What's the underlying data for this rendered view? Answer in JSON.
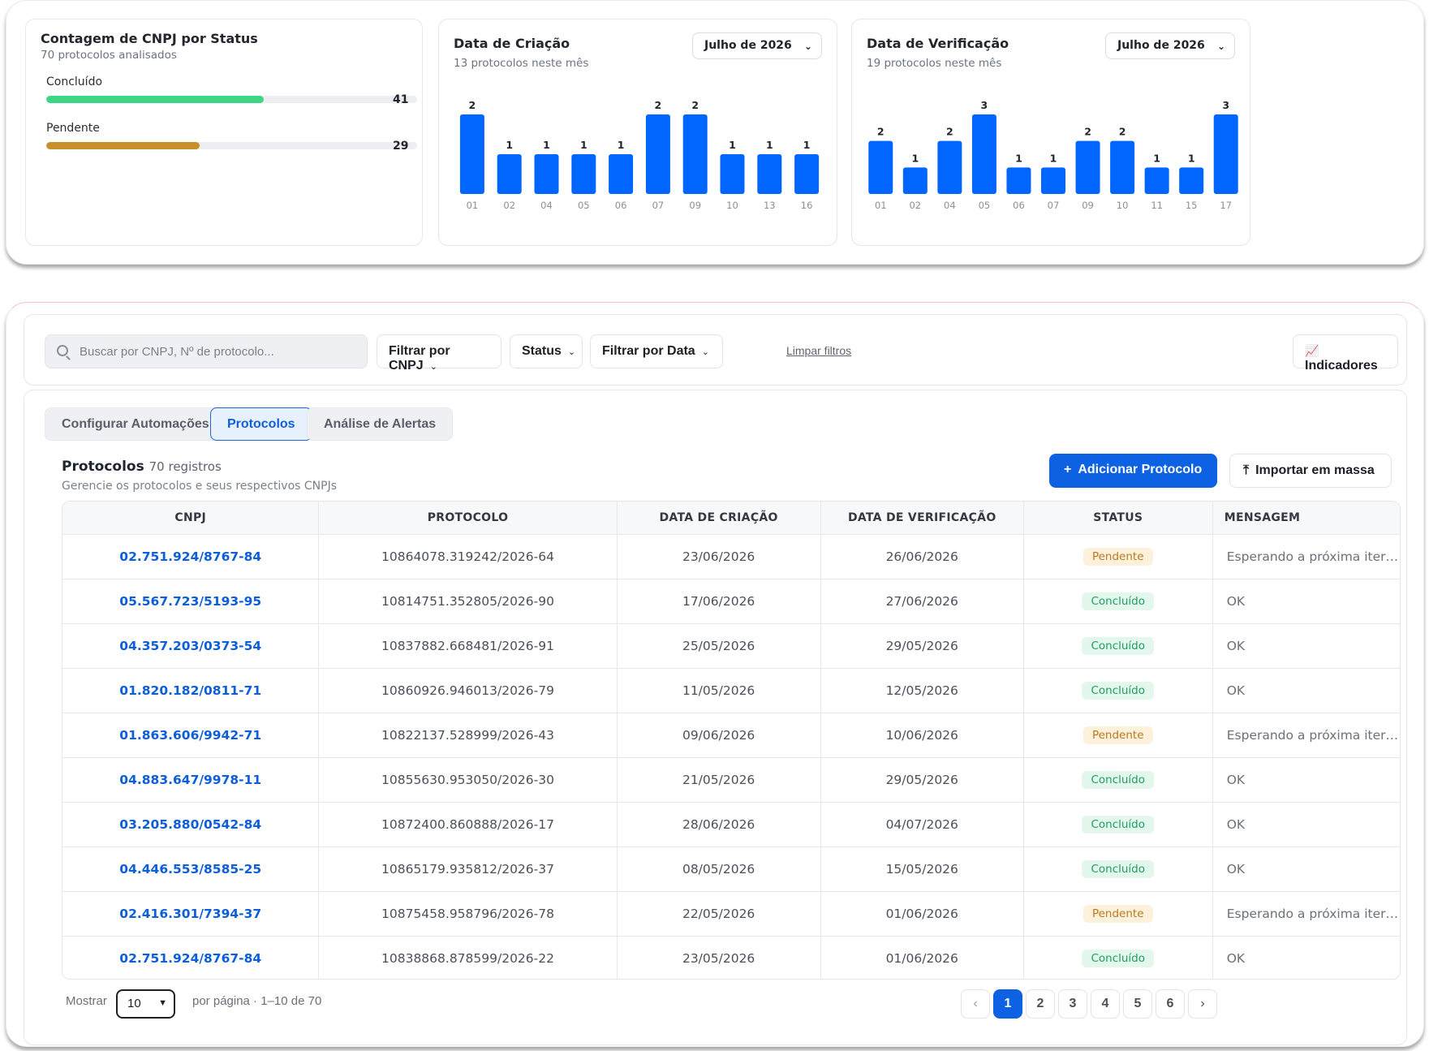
{
  "status_card": {
    "title": "Contagem de CNPJ por Status",
    "subtitle": "70 protocolos analisados",
    "items": [
      {
        "label": "Concluído",
        "count": "41",
        "fraction": 0.586,
        "color": "#3dd685"
      },
      {
        "label": "Pendente",
        "count": "29",
        "fraction": 0.414,
        "color": "#c98f2a"
      }
    ]
  },
  "creation_card": {
    "title": "Data de Criação",
    "subtitle": "13 protocolos neste mês",
    "month": "Julho de 2026"
  },
  "verification_card": {
    "title": "Data de Verificação",
    "subtitle": "19 protocolos neste mês",
    "month": "Julho de 2026"
  },
  "chart_data": [
    {
      "type": "bar",
      "title": "Data de Criação",
      "categories": [
        "01",
        "02",
        "04",
        "05",
        "06",
        "07",
        "09",
        "10",
        "13",
        "16"
      ],
      "values": [
        2,
        1,
        1,
        1,
        1,
        2,
        2,
        1,
        1,
        1
      ],
      "color": "#0066ff",
      "ylim": [
        0,
        2
      ],
      "grid": false
    },
    {
      "type": "bar",
      "title": "Data de Verificação",
      "categories": [
        "01",
        "02",
        "04",
        "05",
        "06",
        "07",
        "09",
        "10",
        "11",
        "15",
        "17"
      ],
      "values": [
        2,
        1,
        2,
        3,
        1,
        1,
        2,
        2,
        1,
        1,
        3
      ],
      "color": "#0066ff",
      "ylim": [
        0,
        3
      ],
      "grid": false
    }
  ],
  "filters": {
    "search_placeholder": "Buscar por CNPJ, Nº de protocolo...",
    "cnpj_label": "Filtrar por CNPJ",
    "status_label": "Status",
    "date_label": "Filtrar por Data",
    "clear_label": "Limpar filtros",
    "indicators_label": "Indicadores"
  },
  "tabs": [
    {
      "label": "Configurar Automações",
      "active": false
    },
    {
      "label": "Protocolos",
      "active": true
    },
    {
      "label": "Análise de Alertas",
      "active": false
    }
  ],
  "section": {
    "title": "Protocolos",
    "count": "70 registros",
    "subtitle": "Gerencie os protocolos e seus respectivos CNPJs",
    "add_label": "Adicionar Protocolo",
    "import_label": "Importar em massa"
  },
  "table": {
    "headers": [
      "CNPJ",
      "PROTOCOLO",
      "DATA DE CRIAÇÃO",
      "DATA DE VERIFICAÇÃO",
      "STATUS",
      "MENSAGEM"
    ],
    "rows": [
      {
        "cnpj": "02.751.924/8767-84",
        "protocolo": "10864078.319242/2026-64",
        "criacao": "23/06/2026",
        "verificacao": "26/06/2026",
        "status": "Pendente",
        "mensagem": "Esperando a próxima itera..."
      },
      {
        "cnpj": "05.567.723/5193-95",
        "protocolo": "10814751.352805/2026-90",
        "criacao": "17/06/2026",
        "verificacao": "27/06/2026",
        "status": "Concluído",
        "mensagem": "OK"
      },
      {
        "cnpj": "04.357.203/0373-54",
        "protocolo": "10837882.668481/2026-91",
        "criacao": "25/05/2026",
        "verificacao": "29/05/2026",
        "status": "Concluído",
        "mensagem": "OK"
      },
      {
        "cnpj": "01.820.182/0811-71",
        "protocolo": "10860926.946013/2026-79",
        "criacao": "11/05/2026",
        "verificacao": "12/05/2026",
        "status": "Concluído",
        "mensagem": "OK"
      },
      {
        "cnpj": "01.863.606/9942-71",
        "protocolo": "10822137.528999/2026-43",
        "criacao": "09/06/2026",
        "verificacao": "10/06/2026",
        "status": "Pendente",
        "mensagem": "Esperando a próxima itera..."
      },
      {
        "cnpj": "04.883.647/9978-11",
        "protocolo": "10855630.953050/2026-30",
        "criacao": "21/05/2026",
        "verificacao": "29/05/2026",
        "status": "Concluído",
        "mensagem": "OK"
      },
      {
        "cnpj": "03.205.880/0542-84",
        "protocolo": "10872400.860888/2026-17",
        "criacao": "28/06/2026",
        "verificacao": "04/07/2026",
        "status": "Concluído",
        "mensagem": "OK"
      },
      {
        "cnpj": "04.446.553/8585-25",
        "protocolo": "10865179.935812/2026-37",
        "criacao": "08/05/2026",
        "verificacao": "15/05/2026",
        "status": "Concluído",
        "mensagem": "OK"
      },
      {
        "cnpj": "02.416.301/7394-37",
        "protocolo": "10875458.958796/2026-78",
        "criacao": "22/05/2026",
        "verificacao": "01/06/2026",
        "status": "Pendente",
        "mensagem": "Esperando a próxima itera..."
      },
      {
        "cnpj": "02.751.924/8767-84",
        "protocolo": "10838868.878599/2026-22",
        "criacao": "23/05/2026",
        "verificacao": "01/06/2026",
        "status": "Concluído",
        "mensagem": "OK"
      }
    ]
  },
  "pagination": {
    "show_label": "Mostrar",
    "page_size": "10",
    "per_page_info": "por página · 1–10 de 70",
    "pages": [
      "1",
      "2",
      "3",
      "4",
      "5",
      "6"
    ],
    "current": "1",
    "prev_icon": "‹",
    "next_icon": "›"
  }
}
